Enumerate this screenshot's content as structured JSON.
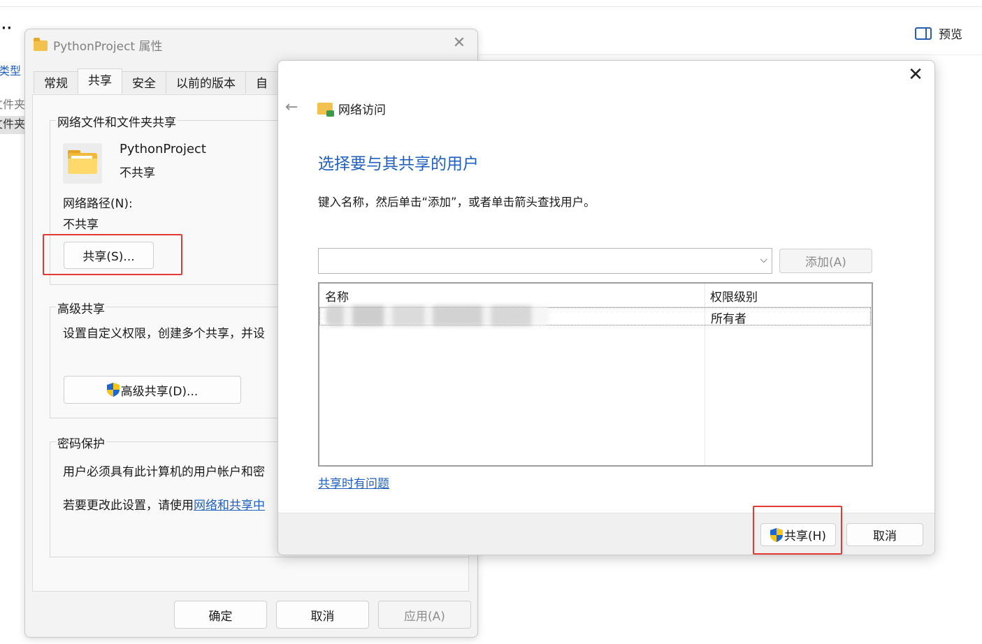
{
  "background": {
    "more_label": "··",
    "preview_label": "预览",
    "col_type": "类型",
    "row1": "文件夹",
    "row2": "文件夹"
  },
  "properties": {
    "title": "PythonProject 属性",
    "tabs": [
      "常规",
      "共享",
      "安全",
      "以前的版本",
      "自"
    ],
    "active_tab": "共享",
    "network_group": {
      "legend": "网络文件和文件夹共享",
      "folder_name": "PythonProject",
      "status": "不共享",
      "path_label": "网络路径(N):",
      "path_value": "不共享",
      "share_button": "共享(S)..."
    },
    "advanced_group": {
      "legend": "高级共享",
      "description": "设置自定义权限，创建多个共享，并设",
      "button": "高级共享(D)..."
    },
    "password_group": {
      "legend": "密码保护",
      "line1": "用户必须具有此计算机的用户帐户和密",
      "line2_prefix": "若要更改此设置，请使用",
      "line2_link": "网络和共享中"
    },
    "buttons": {
      "ok": "确定",
      "cancel": "取消",
      "apply": "应用(A)"
    }
  },
  "network_access": {
    "title": "网络访问",
    "heading": "选择要与其共享的用户",
    "instruction": "键入名称，然后单击“添加”，或者单击箭头查找用户。",
    "combo_value": "",
    "add_button": "添加(A)",
    "table": {
      "col_name": "名称",
      "col_permission": "权限级别",
      "rows": [
        {
          "permission": "所有者"
        }
      ]
    },
    "trouble_link": "共享时有问题",
    "share_button": "共享(H)",
    "cancel_button": "取消"
  },
  "colors": {
    "accent": "#1f5fbf",
    "highlight_box": "#e53935"
  }
}
